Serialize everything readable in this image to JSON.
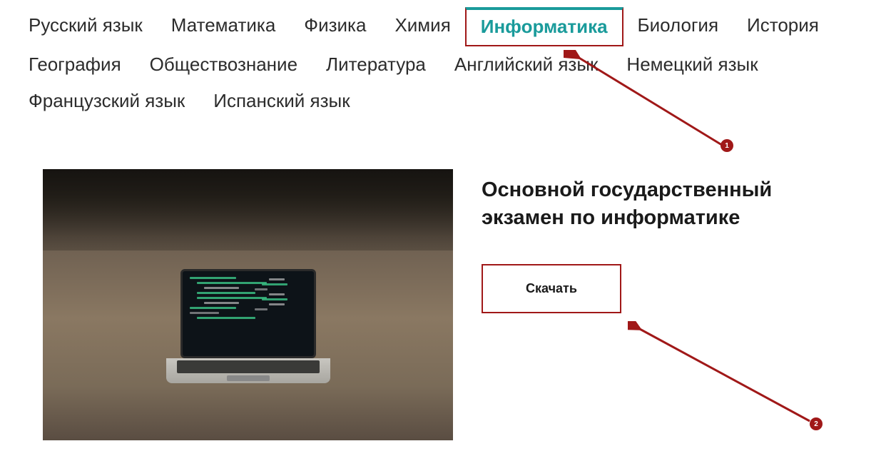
{
  "nav": {
    "items": [
      {
        "label": "Русский язык",
        "active": false
      },
      {
        "label": "Математика",
        "active": false
      },
      {
        "label": "Физика",
        "active": false
      },
      {
        "label": "Химия",
        "active": false
      },
      {
        "label": "Информатика",
        "active": true
      },
      {
        "label": "Биология",
        "active": false
      },
      {
        "label": "История",
        "active": false
      },
      {
        "label": "География",
        "active": false
      },
      {
        "label": "Обществознание",
        "active": false
      },
      {
        "label": "Литература",
        "active": false
      },
      {
        "label": "Английский язык",
        "active": false
      },
      {
        "label": "Немецкий язык",
        "active": false
      },
      {
        "label": "Французский язык",
        "active": false
      },
      {
        "label": "Испанский язык",
        "active": false
      }
    ]
  },
  "content": {
    "heading": "Основной государственный экзамен по информатике",
    "download_label": "Скачать",
    "image_alt": "laptop-on-desk"
  },
  "annotations": {
    "marker1": "1",
    "marker2": "2",
    "colors": {
      "highlight": "#A01818",
      "active_tab": "#1a9b9b"
    }
  }
}
